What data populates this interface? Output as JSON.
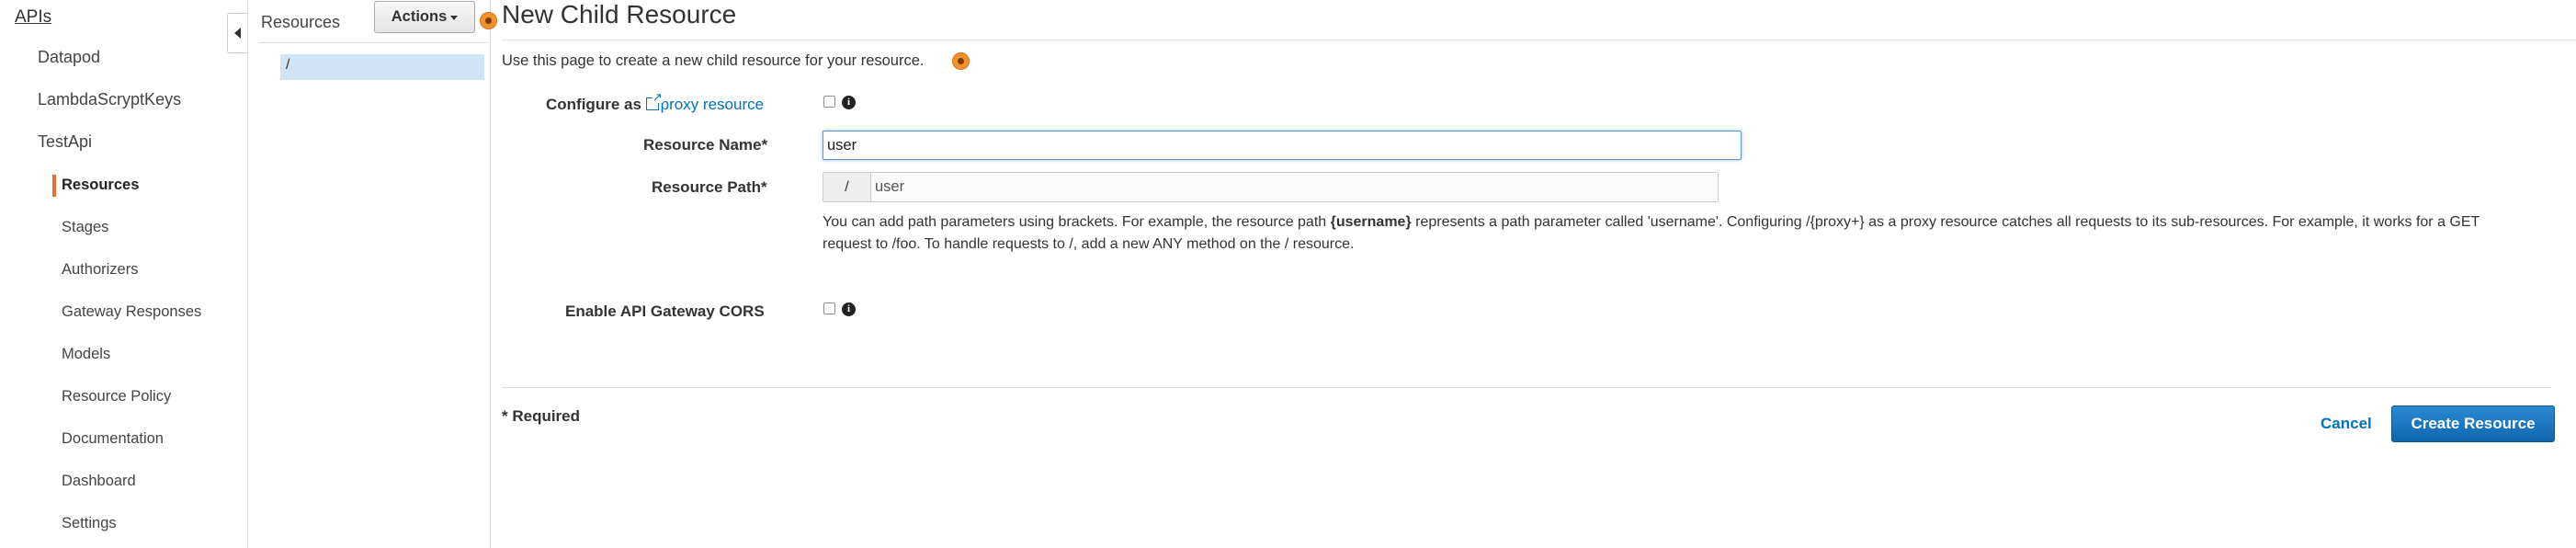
{
  "leftnav": {
    "apis_label": "APIs",
    "apis": [
      "Datapod",
      "LambdaScryptKeys",
      "TestApi"
    ],
    "sub_items": [
      "Resources",
      "Stages",
      "Authorizers",
      "Gateway Responses",
      "Models",
      "Resource Policy",
      "Documentation",
      "Dashboard",
      "Settings"
    ],
    "active_item": "Resources",
    "accent_color": "#e8702a"
  },
  "tree": {
    "title": "Resources",
    "actions_label": "Actions",
    "root": "/"
  },
  "main": {
    "title": "New Child Resource",
    "intro": "Use this page to create a new child resource for your resource.",
    "configure_as_label": "Configure as",
    "proxy_link": "proxy resource",
    "resource_name_label": "Resource Name*",
    "resource_name_value": "user",
    "resource_path_label": "Resource Path*",
    "resource_path_prefix": "/",
    "resource_path_value": "user",
    "help_part1": "You can add path parameters using brackets. For example, the resource path ",
    "help_bold": "{username}",
    "help_part2": " represents a path parameter called 'username'. Configuring /{proxy+} as a proxy resource catches all requests to its sub-resources. For example, it works for a GET request to /foo. To handle requests to /, add a new ANY method on the / resource.",
    "cors_label": "Enable API Gateway CORS",
    "required_note": "* Required",
    "cancel_label": "Cancel",
    "create_label": "Create Resource",
    "info_glyph": "i",
    "link_color": "#0073bb",
    "button_color": "#1a7ac4"
  }
}
